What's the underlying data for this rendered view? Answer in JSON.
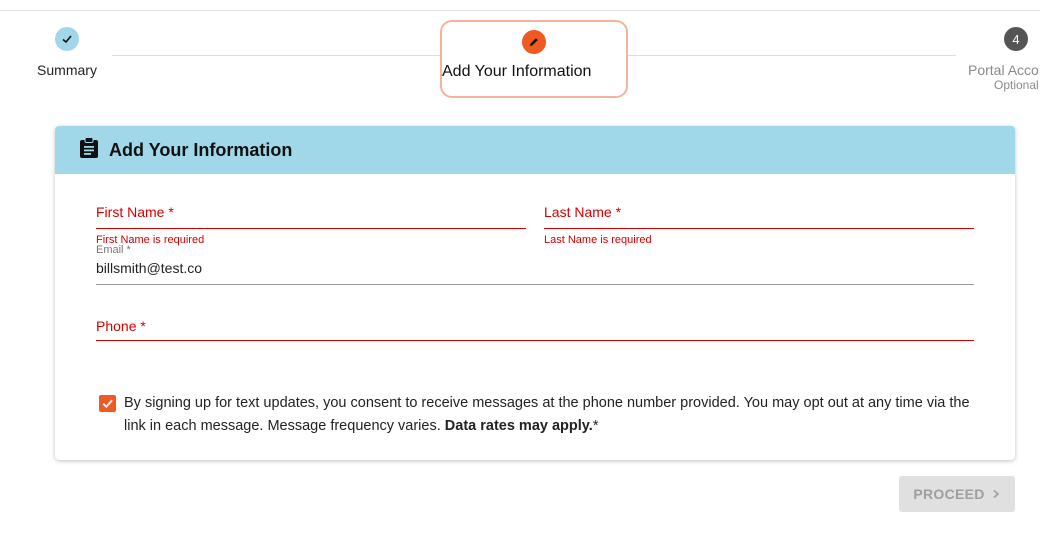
{
  "stepper": {
    "steps": [
      {
        "label": "Summary",
        "state": "complete"
      },
      {
        "label": "Add Your Information",
        "state": "active"
      },
      {
        "label": "Portal Acco",
        "sublabel": "Optional",
        "number": "4",
        "state": "pending"
      }
    ]
  },
  "form": {
    "title": "Add Your Information",
    "first_name": {
      "label": "First Name *",
      "error": "First Name is required"
    },
    "last_name": {
      "label": "Last Name *",
      "error": "Last Name is required"
    },
    "email": {
      "label": "Email *",
      "value": "billsmith@test.co"
    },
    "phone": {
      "label": "Phone *"
    },
    "consent": {
      "checked": true,
      "text": "By signing up for text updates, you consent to receive messages at the phone number provided. You may opt out at any time via the link in each message. Message frequency varies.",
      "bold": "Data rates may apply.",
      "suffix": "*"
    }
  },
  "proceed_label": "PROCEED",
  "colors": {
    "accent": "#f05a22",
    "header_bg": "#a0d8ea",
    "error": "#d50000",
    "complete_step": "#a0d8ea",
    "pending_step": "#555555"
  }
}
